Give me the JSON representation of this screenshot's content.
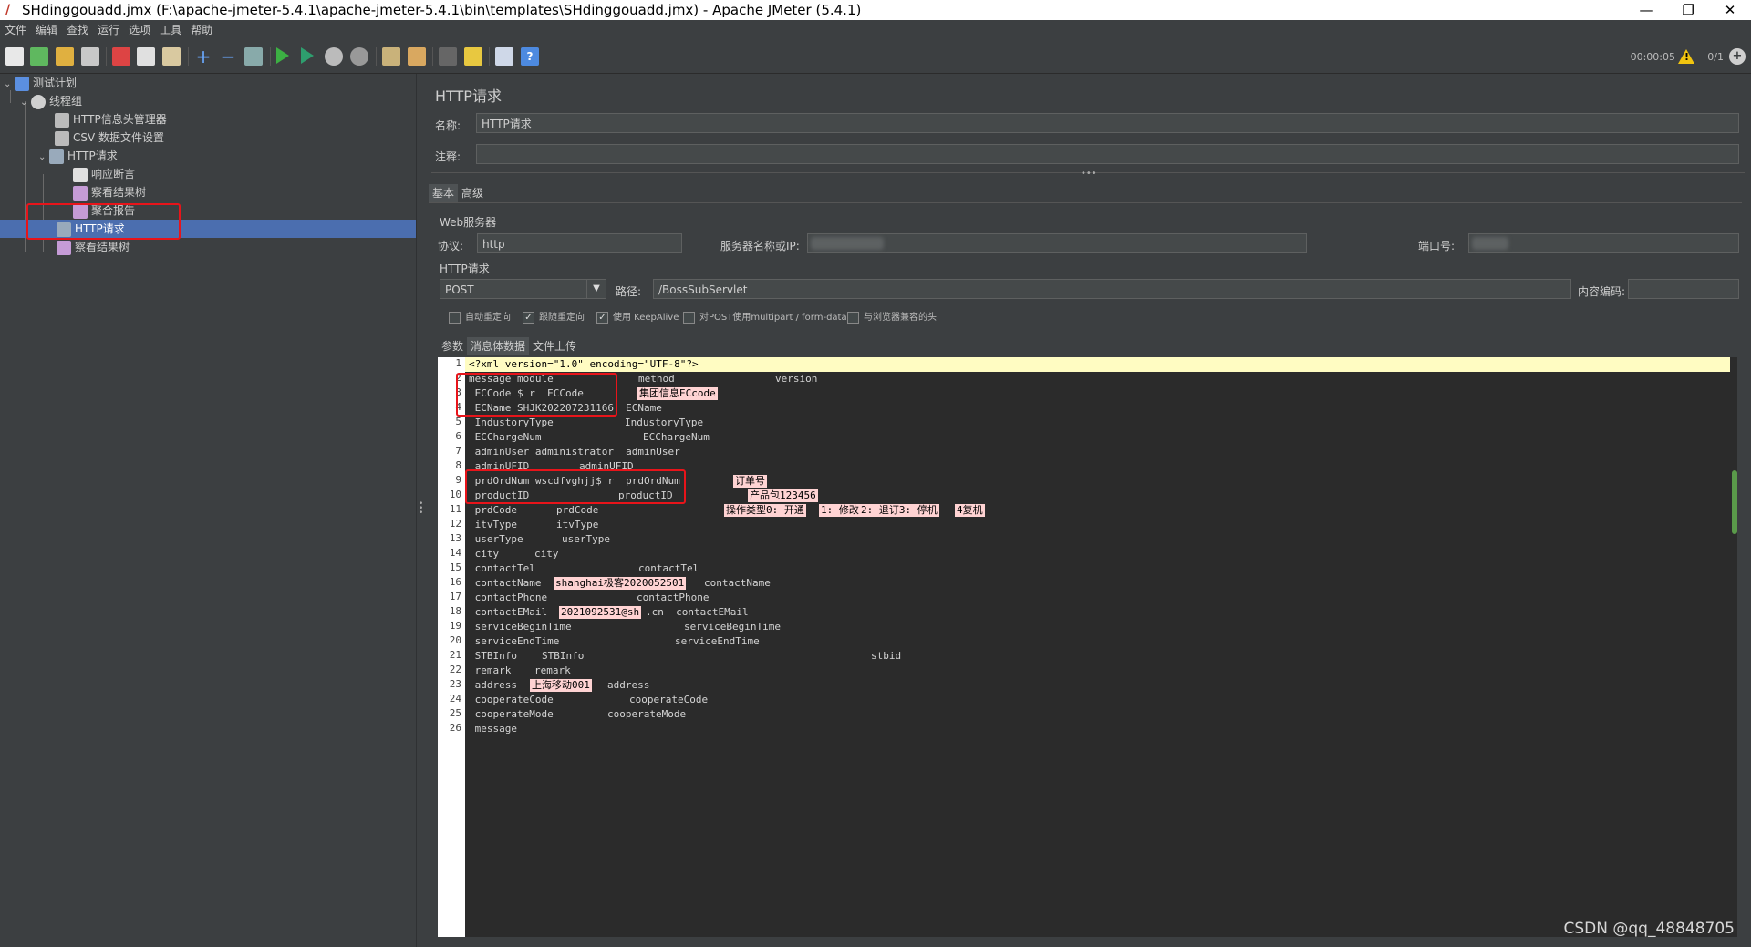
{
  "window": {
    "title": "SHdinggouadd.jmx (F:\\apache-jmeter-5.4.1\\apache-jmeter-5.4.1\\bin\\templates\\SHdinggouadd.jmx) - Apache JMeter (5.4.1)",
    "minimize": "—",
    "maximize": "❐",
    "close": "✕"
  },
  "menu": [
    "文件",
    "编辑",
    "查找",
    "运行",
    "选项",
    "工具",
    "帮助"
  ],
  "toolbar": {
    "timer": "00:00:05",
    "warn_count": "!",
    "thread_counter": "0/1"
  },
  "tree": {
    "items": [
      {
        "label": "测试计划"
      },
      {
        "label": "线程组"
      },
      {
        "label": "HTTP信息头管理器"
      },
      {
        "label": "CSV 数据文件设置"
      },
      {
        "label": "HTTP请求"
      },
      {
        "label": "响应断言"
      },
      {
        "label": "察看结果树"
      },
      {
        "label": "聚合报告"
      },
      {
        "label": "HTTP请求"
      },
      {
        "label": "察看结果树"
      }
    ]
  },
  "panel": {
    "title": "HTTP请求",
    "name_label": "名称:",
    "name_value": "HTTP请求",
    "comment_label": "注释:",
    "comment_value": "",
    "tabs": [
      "基本",
      "高级"
    ],
    "web_server_section": "Web服务器",
    "protocol_label": "协议:",
    "protocol_value": "http",
    "server_label": "服务器名称或IP:",
    "port_label": "端口号:",
    "http_section": "HTTP请求",
    "method_value": "POST",
    "path_label": "路径:",
    "path_value": "/BossSubServlet",
    "encoding_label": "内容编码:",
    "encoding_value": "",
    "checkboxes": [
      {
        "label": "自动重定向",
        "checked": false
      },
      {
        "label": "跟随重定向",
        "checked": true
      },
      {
        "label": "使用 KeepAlive",
        "checked": true
      },
      {
        "label": "对POST使用multipart / form-data",
        "checked": false
      },
      {
        "label": "与浏览器兼容的头",
        "checked": false
      }
    ],
    "body_tabs": [
      "参数",
      "消息体数据",
      "文件上传"
    ]
  },
  "editor": {
    "lines": [
      "<?xml version=\"1.0\" encoding=\"UTF-8\"?>",
      "message module",
      " ECCode $ r  ECCode",
      " ECName SHJK202207231166  ECName",
      " IndustoryType",
      " ECChargeNum",
      " adminUser administrator  adminUser",
      " adminUFID",
      " prdOrdNum wscdfvghjj$ r  prdOrdNum",
      " productID",
      " prdCode",
      " itvType",
      " userType",
      " city",
      " contactTel",
      " contactName",
      " contactPhone",
      " contactEMail",
      " serviceBeginTime",
      " serviceEndTime",
      " STBInfo",
      " remark",
      " address",
      " cooperateCode",
      " cooperateMode",
      " message"
    ],
    "line_numbers": [
      "1",
      "2",
      "3",
      "4",
      "5",
      "6",
      "7",
      "8",
      "9",
      "10",
      "11",
      "12",
      "13",
      "14",
      "15",
      "16",
      "17",
      "18",
      "19",
      "20",
      "21",
      "22",
      "23",
      "24",
      "25",
      "26"
    ],
    "line2_method": "method",
    "line2_version": "version",
    "line5_tail": "IndustoryType",
    "line6_tail": "ECChargeNum",
    "line8_tail": "adminUFID",
    "line10_tail": "productID",
    "line11_tail": "prdCode",
    "line12_tail": "itvType",
    "line13_tail": "userType",
    "line14_tail": "city",
    "line15_tail": "contactTel",
    "line16_value": "shanghai极客2020052501",
    "line16_tail": "contactName",
    "line17_tail": "contactPhone",
    "line18_value": "2021092531@sh",
    "line18_tail": ".cn  contactEMail",
    "line19_tail": "serviceBeginTime",
    "line20_tail": "serviceEndTime",
    "line21_tail": "STBInfo",
    "line21_stbid": "stbid",
    "line22_tail": "remark",
    "line23_value": "上海移动001",
    "line23_tail": "address",
    "line24_tail": "cooperateCode",
    "line25_tail": "cooperateMode",
    "annotations": {
      "ec_code": "集团信息ECcode",
      "order_no": "订单号",
      "product_pkg": "产品包123456",
      "op_type": "操作类型0: 开通",
      "op_1": "1: 修改",
      "op_2": "2: 退订3: 停机",
      "op_4": "4复机"
    }
  },
  "watermark": "CSDN @qq_48848705"
}
